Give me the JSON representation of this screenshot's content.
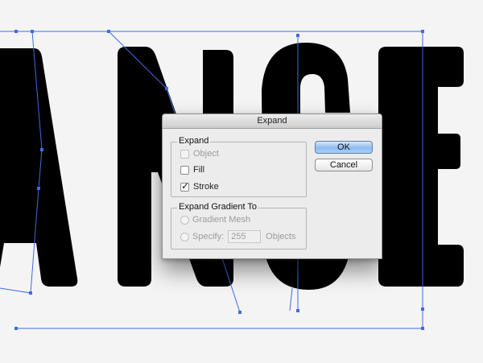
{
  "canvas": {
    "letters": [
      "A",
      "N",
      "C",
      "E"
    ],
    "paper_color": "#f4f4f4",
    "selection_color": "#3e6ce1"
  },
  "dialog": {
    "title": "Expand",
    "expand_group": {
      "title": "Expand",
      "object": {
        "label": "Object",
        "checked": false,
        "enabled": false
      },
      "fill": {
        "label": "Fill",
        "checked": false,
        "enabled": true
      },
      "stroke": {
        "label": "Stroke",
        "checked": true,
        "enabled": true
      }
    },
    "gradient_group": {
      "title": "Expand Gradient To",
      "gradient_mesh": {
        "label": "Gradient Mesh",
        "enabled": false
      },
      "specify": {
        "label": "Specify:",
        "value": "255",
        "unit": "Objects",
        "enabled": false
      }
    },
    "buttons": {
      "ok": "OK",
      "cancel": "Cancel"
    }
  }
}
